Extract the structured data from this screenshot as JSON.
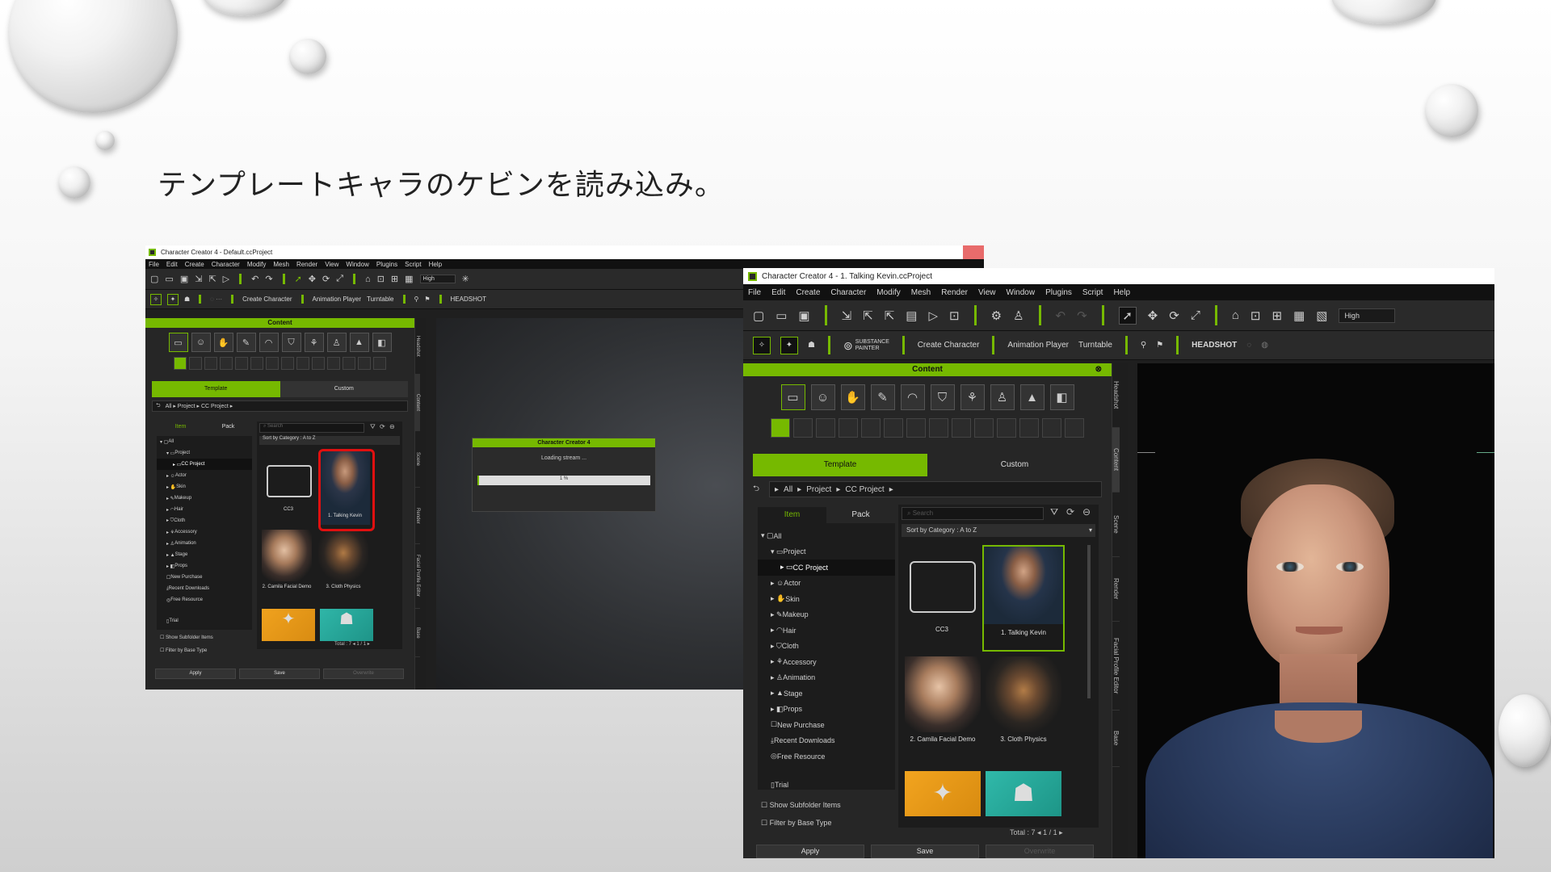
{
  "slide": {
    "title": "テンプレートキャラのケビンを読み込み。"
  },
  "left_window": {
    "title": "Character Creator 4 - Default.ccProject",
    "menu": [
      "File",
      "Edit",
      "Create",
      "Character",
      "Modify",
      "Mesh",
      "Render",
      "View",
      "Window",
      "Plugins",
      "Script",
      "Help"
    ],
    "quality": "High",
    "toolbar2": {
      "create_character": "Create Character",
      "animation_player": "Animation Player",
      "turntable": "Turntable",
      "headshot": "HEADSHOT"
    },
    "content_title": "Content",
    "tabs": [
      "Template",
      "Custom"
    ],
    "breadcrumb": "All ▸ Project ▸ CC Project ▸",
    "subtabs": [
      "Item",
      "Pack"
    ],
    "search_placeholder": "Search",
    "sort": "Sort by Category : A to Z",
    "tree": [
      "All",
      "Project",
      "CC Project",
      "Actor",
      "Skin",
      "Makeup",
      "Hair",
      "Cloth",
      "Accessory",
      "Animation",
      "Stage",
      "Props",
      "New Purchase",
      "Recent Downloads",
      "Free Resource",
      "Trial"
    ],
    "items": [
      "CC3",
      "1. Talking Kevin",
      "2. Camila Facial Demo",
      "3. Cloth Physics"
    ],
    "checkboxes": [
      "Show Subfolder Items",
      "Filter by Base Type"
    ],
    "total": "Total : 7",
    "page": "1 / 1",
    "buttons": [
      "Apply",
      "Save",
      "Overwrite"
    ],
    "side_tabs": [
      "Headshot",
      "Content",
      "Scene",
      "Render",
      "Facial Profile Editor",
      "Base"
    ],
    "loading": {
      "title": "Character Creator 4",
      "text": "Loading stream ...",
      "percent": "1 %",
      "progress": 0.01
    }
  },
  "right_window": {
    "title": "Character Creator 4 - 1. Talking Kevin.ccProject",
    "menu": [
      "File",
      "Edit",
      "Create",
      "Character",
      "Modify",
      "Mesh",
      "Render",
      "View",
      "Window",
      "Plugins",
      "Script",
      "Help"
    ],
    "quality": "High",
    "toolbar2": {
      "substance": "SUBSTANCE PAINTER",
      "create_character": "Create Character",
      "animation_player": "Animation Player",
      "turntable": "Turntable",
      "headshot": "HEADSHOT"
    },
    "content_title": "Content",
    "tabs": [
      "Template",
      "Custom"
    ],
    "breadcrumb": [
      "All",
      "Project",
      "CC Project"
    ],
    "subtabs": [
      "Item",
      "Pack"
    ],
    "search_placeholder": "Search",
    "sort": "Sort by Category : A to Z",
    "tree": [
      "All",
      "Project",
      "CC Project",
      "Actor",
      "Skin",
      "Makeup",
      "Hair",
      "Cloth",
      "Accessory",
      "Animation",
      "Stage",
      "Props",
      "New Purchase",
      "Recent Downloads",
      "Free Resource",
      "Trial"
    ],
    "items": [
      "CC3",
      "1. Talking Kevin",
      "2. Camila Facial Demo",
      "3. Cloth Physics"
    ],
    "checkboxes": [
      "Show Subfolder Items",
      "Filter by Base Type"
    ],
    "total": "Total : 7",
    "page": "1 / 1",
    "buttons": [
      "Apply",
      "Save",
      "Overwrite"
    ],
    "side_tabs": [
      "Headshot",
      "Content",
      "Scene",
      "Render",
      "Facial Profile Editor",
      "Base"
    ]
  }
}
